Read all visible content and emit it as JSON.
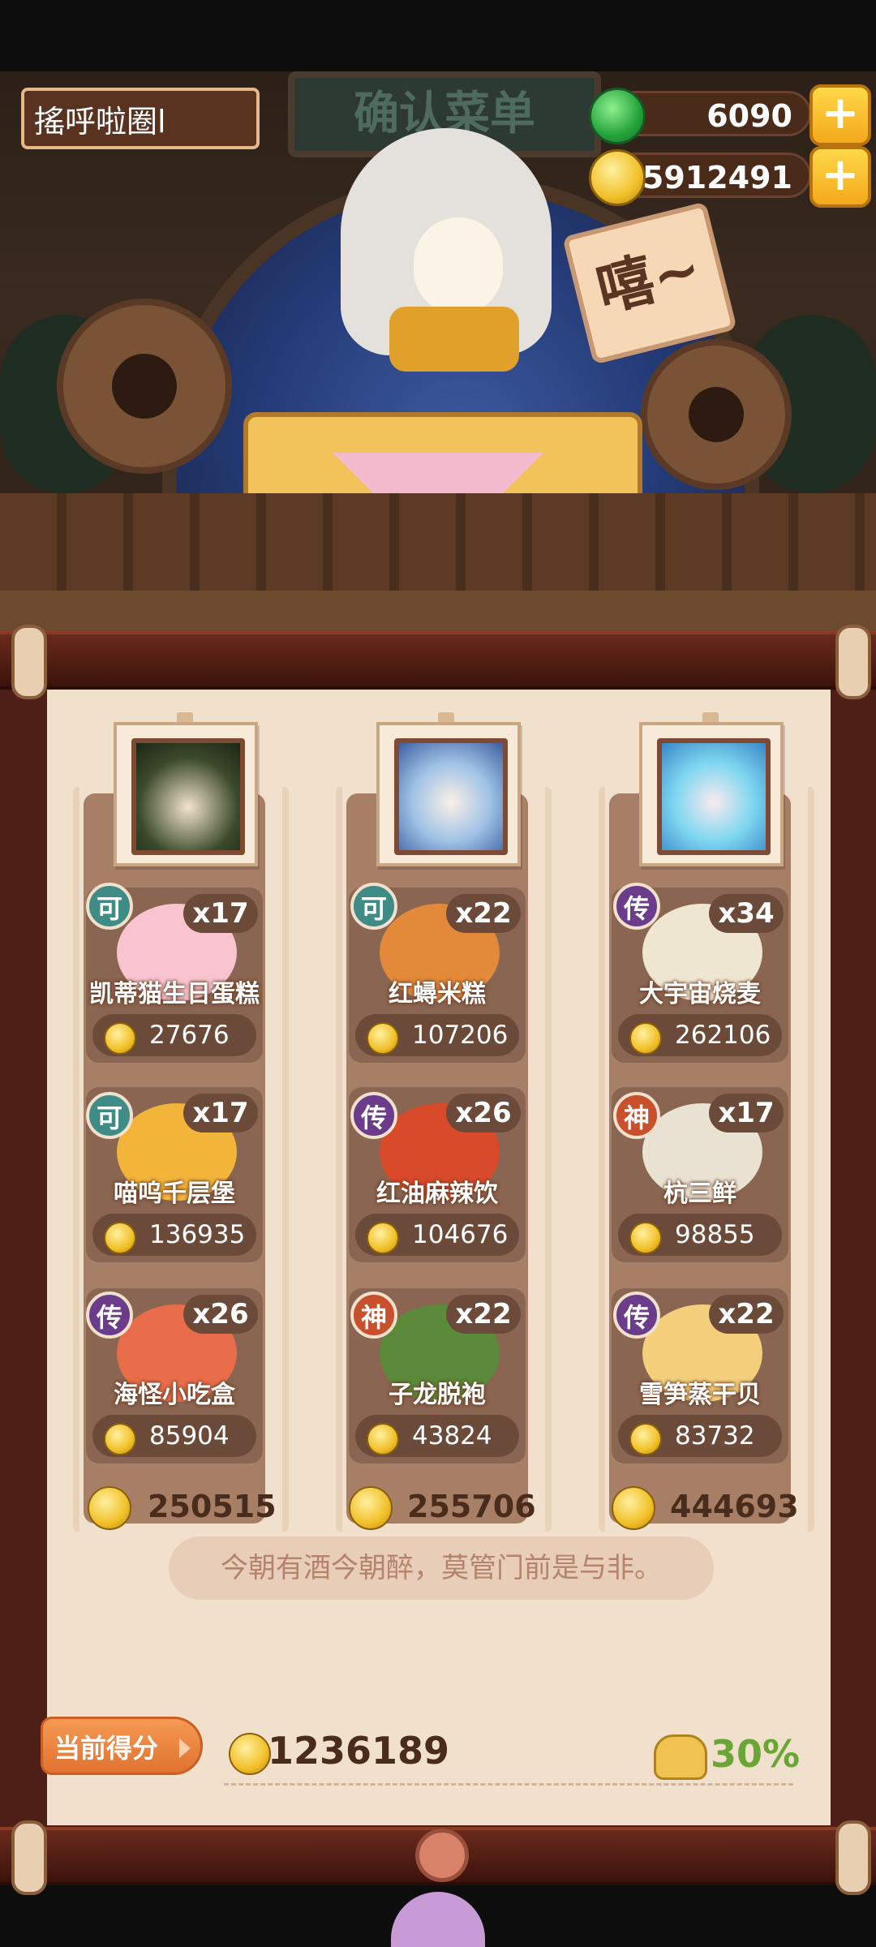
{
  "hud": {
    "player_name": "搖呼啦圈l",
    "jade_amount": "6090",
    "gold_amount": "15912491",
    "plus_label": "+"
  },
  "scene": {
    "banner_text": "确认菜单",
    "signboard_text": "嘻~"
  },
  "columns": [
    {
      "total": "250515",
      "portrait": "witch-cat-character",
      "dishes": [
        {
          "rarity": "可",
          "rarity_color": "#3f8c86",
          "name": "凯蒂猫生日蛋糕",
          "qty": "x17",
          "price": "27676",
          "color": "#f7c4cf"
        },
        {
          "rarity": "可",
          "rarity_color": "#3f8c86",
          "name": "喵呜千层堡",
          "qty": "x17",
          "price": "136935",
          "color": "#f2b53a"
        },
        {
          "rarity": "传",
          "rarity_color": "#6b3c8a",
          "name": "海怪小吃盒",
          "qty": "x26",
          "price": "85904",
          "color": "#e96d4a"
        }
      ]
    },
    {
      "total": "255706",
      "portrait": "white-hair-boy-character",
      "dishes": [
        {
          "rarity": "可",
          "rarity_color": "#3f8c86",
          "name": "红蟳米糕",
          "qty": "x22",
          "price": "107206",
          "color": "#e38a3a"
        },
        {
          "rarity": "传",
          "rarity_color": "#6b3c8a",
          "name": "红油麻辣饮",
          "qty": "x26",
          "price": "104676",
          "color": "#d94a2a"
        },
        {
          "rarity": "神",
          "rarity_color": "#c8502c",
          "name": "子龙脱袍",
          "qty": "x22",
          "price": "43824",
          "color": "#5a8a3a"
        }
      ]
    },
    {
      "total": "444693",
      "portrait": "blue-hair-girl-character",
      "dishes": [
        {
          "rarity": "传",
          "rarity_color": "#6b3c8a",
          "name": "大宇宙烧麦",
          "qty": "x34",
          "price": "262106",
          "color": "#efe6d2"
        },
        {
          "rarity": "神",
          "rarity_color": "#c8502c",
          "name": "杭三鲜",
          "qty": "x17",
          "price": "98855",
          "color": "#e9e2d2"
        },
        {
          "rarity": "传",
          "rarity_color": "#6b3c8a",
          "name": "雪笋蒸干贝",
          "qty": "x22",
          "price": "83732",
          "color": "#f3cf7c"
        }
      ]
    }
  ],
  "quote": "今朝有酒今朝醉，莫管门前是与非。",
  "score": {
    "label": "当前得分",
    "value": "1236189",
    "bonus_percent": "30%"
  }
}
